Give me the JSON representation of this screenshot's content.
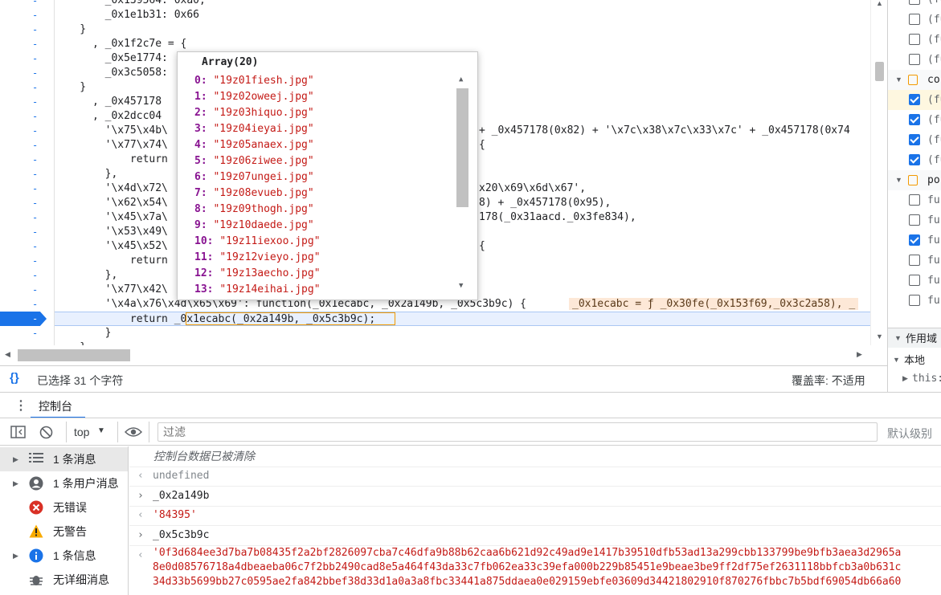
{
  "editor": {
    "gutter_marker": "-",
    "code_lines": [
      {
        "t": "        _0x139564: 0xa0,"
      },
      {
        "t": "        _0x1e1b31: 0x66"
      },
      {
        "t": "    }"
      },
      {
        "t": "      , _0x1f2c7e = {"
      },
      {
        "t": "        _0x5e1774:"
      },
      {
        "t": "        _0x3c5058:"
      },
      {
        "t": "    }"
      },
      {
        "t": "      , _0x457178"
      },
      {
        "t": "      , _0x2dcc04"
      },
      {
        "t": "        '\\x75\\x4b\\"
      },
      {
        "t": "        '\\x77\\x74\\"
      },
      {
        "t": "            return"
      },
      {
        "t": "        },"
      },
      {
        "t": "        '\\x4d\\x72\\"
      },
      {
        "t": "        '\\x62\\x54\\"
      },
      {
        "t": "        '\\x45\\x7a\\"
      },
      {
        "t": "        '\\x53\\x49\\"
      },
      {
        "t": "        '\\x45\\x52\\"
      },
      {
        "t": "            return"
      },
      {
        "t": "        },"
      },
      {
        "t": "        '\\x77\\x42\\"
      },
      {
        "t": "        '\\x4a\\x76\\x4d\\x65\\x69': function(_0x1ecabc, _0x2a149b, _0x5c3b9c) {"
      },
      {
        "t": "            return _0x1ecabc(_0x2a149b, _0x5c3b9c);"
      },
      {
        "t": "        }"
      },
      {
        "t": "    }"
      }
    ],
    "right_fragments": [
      {
        "line": 9,
        "text": "+ _0x457178(0x82) + '\\x7c\\x38\\x7c\\x33\\x7c' + _0x457178(0x74"
      },
      {
        "line": 10,
        "text": "{"
      },
      {
        "line": 13,
        "text": "x20\\x69\\x6d\\x67',"
      },
      {
        "line": 14,
        "text": "8) + _0x457178(0x95),"
      },
      {
        "line": 15,
        "text": "178(_0x31aacd._0x3fe834),"
      },
      {
        "line": 17,
        "text": "{"
      }
    ],
    "inline_value": "_0x1ecabc = ƒ _0x30fe(_0x153f69,_0x3c2a58), _"
  },
  "popover": {
    "title": "Array(20)",
    "items": [
      {
        "k": "0",
        "v": "\"19z01fiesh.jpg\""
      },
      {
        "k": "1",
        "v": "\"19z02oweej.jpg\""
      },
      {
        "k": "2",
        "v": "\"19z03hiquo.jpg\""
      },
      {
        "k": "3",
        "v": "\"19z04ieyai.jpg\""
      },
      {
        "k": "4",
        "v": "\"19z05anaex.jpg\""
      },
      {
        "k": "5",
        "v": "\"19z06ziwee.jpg\""
      },
      {
        "k": "6",
        "v": "\"19z07ungei.jpg\""
      },
      {
        "k": "7",
        "v": "\"19z08evueb.jpg\""
      },
      {
        "k": "8",
        "v": "\"19z09thogh.jpg\""
      },
      {
        "k": "9",
        "v": "\"19z10daede.jpg\""
      },
      {
        "k": "10",
        "v": "\"19z11iexoo.jpg\""
      },
      {
        "k": "11",
        "v": "\"19z12vieyo.jpg\""
      },
      {
        "k": "12",
        "v": "\"19z13aecho.jpg\""
      },
      {
        "k": "13",
        "v": "\"19z14eihai.jpg\""
      }
    ]
  },
  "right_panel": {
    "rows": [
      {
        "type": "cb",
        "checked": false,
        "text": "(fu"
      },
      {
        "type": "cb",
        "checked": false,
        "text": "(fu"
      },
      {
        "type": "cb",
        "checked": false,
        "text": "(fu"
      },
      {
        "type": "cb",
        "checked": false,
        "text": "(fu"
      },
      {
        "type": "group",
        "text": "cor"
      },
      {
        "type": "cb",
        "checked": true,
        "text": "(fu",
        "selected": true
      },
      {
        "type": "cb",
        "checked": true,
        "text": "(fu"
      },
      {
        "type": "cb",
        "checked": true,
        "text": "(fu"
      },
      {
        "type": "cb",
        "checked": true,
        "text": "(fu"
      },
      {
        "type": "group",
        "text": "po"
      },
      {
        "type": "cb",
        "checked": false,
        "text": "fur"
      },
      {
        "type": "cb",
        "checked": false,
        "text": "fur"
      },
      {
        "type": "cb",
        "checked": true,
        "text": "fur"
      },
      {
        "type": "cb",
        "checked": false,
        "text": "fur"
      },
      {
        "type": "cb",
        "checked": false,
        "text": "fur"
      },
      {
        "type": "cb",
        "checked": false,
        "text": "fur"
      }
    ],
    "scope_header": "作用域",
    "local_header": "本地",
    "this_label": "this:"
  },
  "status": {
    "selection": "已选择 31 个字符",
    "coverage": "覆盖率: 不适用"
  },
  "drawer": {
    "tab_label": "控制台"
  },
  "toolbar": {
    "context": "top",
    "filter_placeholder": "过滤",
    "level": "默认级别"
  },
  "sidebar": {
    "items": [
      {
        "label": "1 条消息",
        "icon": "list-icon"
      },
      {
        "label": "1 条用户消息",
        "icon": "user-icon"
      },
      {
        "label": "无错误",
        "icon": "error-icon"
      },
      {
        "label": "无警告",
        "icon": "warning-icon"
      },
      {
        "label": "1 条信息",
        "icon": "info-icon"
      },
      {
        "label": "无详细消息",
        "icon": "bug-icon"
      }
    ]
  },
  "console": {
    "cleared": "控制台数据已被清除",
    "rows": [
      {
        "kind": "out",
        "text": "undefined"
      },
      {
        "kind": "in",
        "text": "_0x2a149b"
      },
      {
        "kind": "out",
        "text": "'84395'"
      },
      {
        "kind": "in",
        "text": "_0x5c3b9c"
      }
    ],
    "long_value": [
      "'0f3d684ee3d7ba7b08435f2a2bf2826097cba7c46dfa9b88b62caa6b621d92c49ad9e1417b39510dfb53ad13a299cbb133799be9bfb3aea3d2965a",
      "8e0d08576718a4dbeaeba06c7f2bb2490cad8e5a464f43da33c7fb062ea33c39efa000b229b85451e9beae3be9ff2df75ef2631118bbfcb3a0b631c",
      "34d33b5699bb27c0595ae2fa842bbef38d33d1a0a3a8fbc33441a875ddaea0e029159ebfe03609d34421802910f870276fbbc7b5bdf69054db66a60"
    ]
  }
}
